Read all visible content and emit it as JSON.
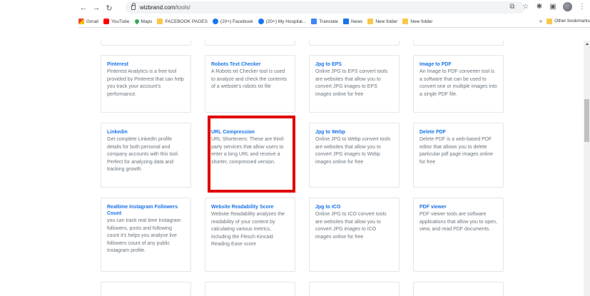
{
  "browser": {
    "url_domain": "wizbrand.com",
    "url_path": "/tools/",
    "icons": {
      "back": "back-arrow-icon",
      "forward": "forward-arrow-icon",
      "reload": "reload-icon",
      "share": "share-icon",
      "star": "star-icon",
      "extensions": "puzzle-icon",
      "sidebar": "sidebar-icon",
      "menu": "kebab-menu-icon"
    },
    "bookmarks": [
      {
        "label": "Gmail",
        "icon": "gmail-icon"
      },
      {
        "label": "YouTube",
        "icon": "youtube-icon"
      },
      {
        "label": "Maps",
        "icon": "maps-icon"
      },
      {
        "label": "FACEBOOK PAGES",
        "icon": "folder-icon"
      },
      {
        "label": "(20+) Facebook",
        "icon": "facebook-icon"
      },
      {
        "label": "(20+) My Hospital...",
        "icon": "facebook-icon"
      },
      {
        "label": "Translate",
        "icon": "translate-icon"
      },
      {
        "label": "News",
        "icon": "news-icon"
      },
      {
        "label": "New folder",
        "icon": "folder-icon"
      },
      {
        "label": "New folder",
        "icon": "folder-icon"
      }
    ],
    "more_bookmarks": "»",
    "other_bookmarks": "Other bookmarks"
  },
  "tools": [
    {
      "title": "Pinterest",
      "desc": "Pinterest Analytics is a free tool provided by Pinterest that can help you track your account's performance."
    },
    {
      "title": "Robots Text Checker",
      "desc": "A Robots txt Checker tool is used to analyze and check the contents of a website's robots txt file"
    },
    {
      "title": "Jpg to EPS",
      "desc": "Online JPG to EPS convert tools are websites that allow you to convert JPG images to EPS images online for free"
    },
    {
      "title": "Image to PDF",
      "desc": "An Image to PDF converter tool is a software that can be used to convert one or multiple images into a single PDF file."
    },
    {
      "title": "Linkedin",
      "desc": "Get complete LinkedIn profile details for both personal and company accounts with this tool. Perfect for analyzing data and tracking growth."
    },
    {
      "title": "URL Compression",
      "desc": "URL Shorteners: These are third-party services that allow users to enter a long URL and receive a shorter, compressed version."
    },
    {
      "title": "Jpg to Webp",
      "desc": "Online JPG to Webp convert tools are websites that allow you to convert JPG images to Webp images online for free"
    },
    {
      "title": "Delete PDF",
      "desc": "Delete PDF is a web-based PDF editor that allows you to delete particular pdf page images online for free"
    },
    {
      "title": "Realtime Instagram Followers Count",
      "desc": "you can track real time Instagram followers, posts and following count it's helps you analyse live followers count of any public Instagram profile."
    },
    {
      "title": "Website Readability Score",
      "desc": "Website Readability analyzes the readability of your content by calculating various metrics, including the Flesch Kincaid Reading Ease score"
    },
    {
      "title": "Jpg to ICO",
      "desc": "Online JPG to ICO convert tools are websites that allow you to convert JPG images to ICO images online for free"
    },
    {
      "title": "PDF viewer",
      "desc": "PDF viewer tools are software applications that allow you to open, view, and read PDF documents."
    }
  ],
  "highlight_color": "#e00000",
  "accent": "#1a73e8"
}
